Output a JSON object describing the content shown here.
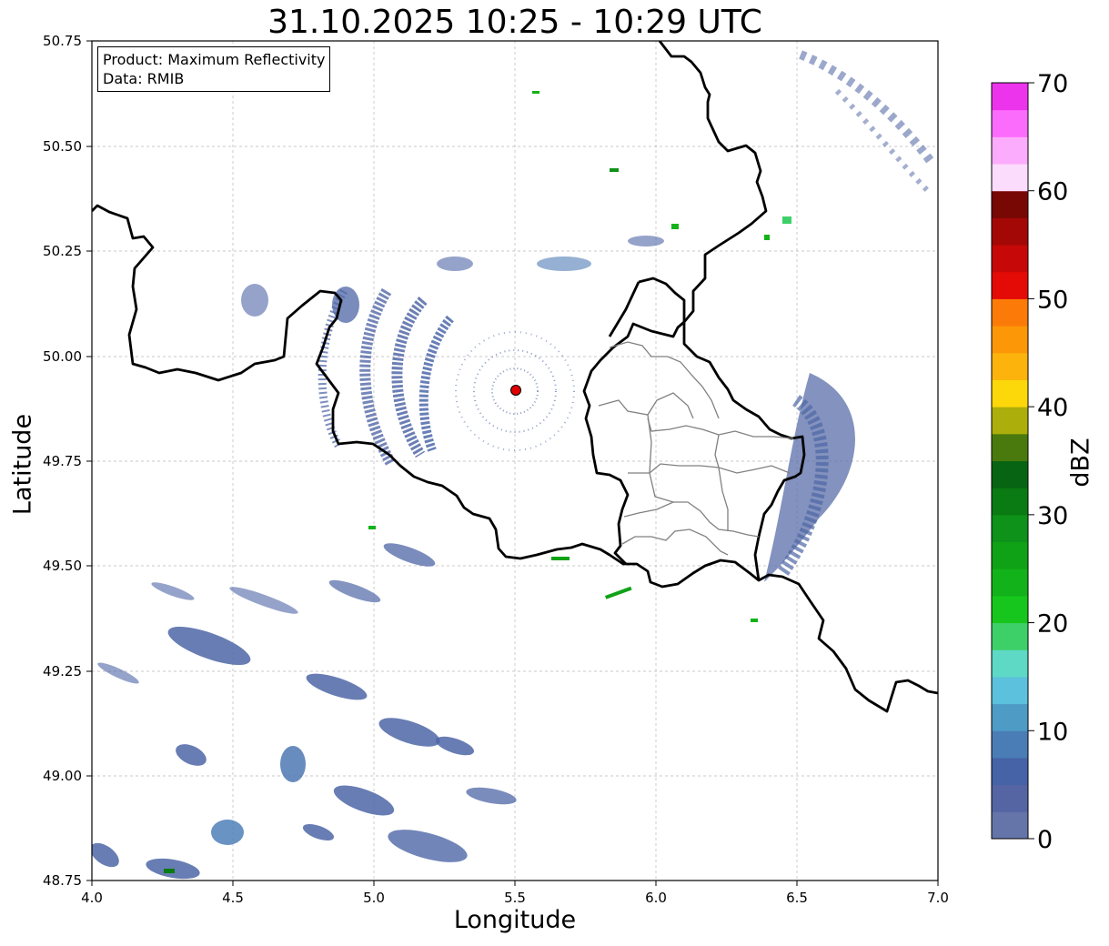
{
  "title": "31.10.2025 10:25 - 10:29 UTC",
  "xlabel": "Longitude",
  "ylabel": "Latitude",
  "info": {
    "line1": "Product: Maximum Reflectivity",
    "line2": "Data: RMIB"
  },
  "colorbar": {
    "label": "dBZ",
    "min": 0,
    "max": 70,
    "ticks": [
      0,
      10,
      20,
      30,
      40,
      50,
      60,
      70
    ],
    "tick_labels": [
      "0",
      "10",
      "20",
      "30",
      "40",
      "50",
      "60",
      "70"
    ],
    "colors": [
      "#6575aa",
      "#5565a4",
      "#4563a6",
      "#4a7db5",
      "#4e9bc6",
      "#5cc1dc",
      "#5dd9c6",
      "#3dd068",
      "#16c61c",
      "#12b21a",
      "#10a216",
      "#0e921a",
      "#0a7a12",
      "#076412",
      "#4a7a0e",
      "#acae0c",
      "#fcd70a",
      "#fcb30c",
      "#fc9708",
      "#fc7b08",
      "#e40a06",
      "#c60808",
      "#a40806",
      "#780804",
      "#fcdcfc",
      "#fcacfc",
      "#fc6cfc",
      "#ec34ec"
    ]
  },
  "map": {
    "lon_range": [
      4.0,
      7.0
    ],
    "lat_range": [
      48.75,
      50.75
    ],
    "x_ticks": [
      "4.0",
      "4.5",
      "5.0",
      "5.5",
      "6.0",
      "6.5",
      "7.0"
    ],
    "y_ticks": [
      "48.75",
      "49.00",
      "49.25",
      "49.50",
      "49.75",
      "50.00",
      "50.25",
      "50.50",
      "50.75"
    ],
    "radar_site": {
      "lon": 5.505,
      "lat": 49.915,
      "color": "#e00000"
    },
    "grid": true
  }
}
